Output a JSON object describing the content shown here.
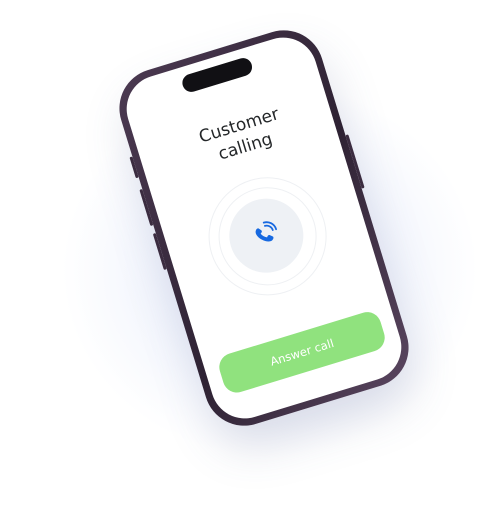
{
  "call": {
    "title": "Customer calling",
    "answer_label": "Answer call"
  },
  "icons": {
    "call": "phone-ringing-icon"
  },
  "colors": {
    "accent_blue": "#1769e0",
    "answer_green": "#90e27e",
    "frame": "#3a2b3f"
  }
}
